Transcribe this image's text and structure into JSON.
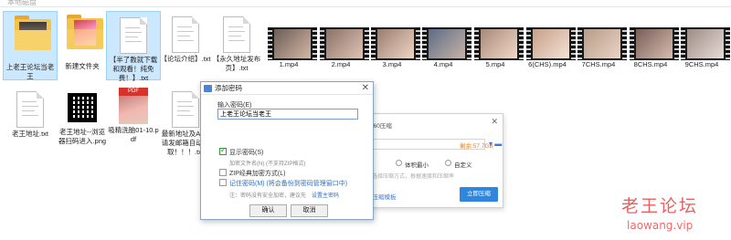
{
  "topbar": {
    "crumb": "本地磁盘"
  },
  "files_row1": [
    {
      "name": "上老王论坛当老王",
      "type": "folder-photo",
      "selected": true
    },
    {
      "name": "新建文件夹",
      "type": "folder-cover",
      "selected": false
    },
    {
      "name": "【半了教就下载和观看！纯免费！】.txt",
      "type": "txt",
      "selected": true
    },
    {
      "name": "【论坛介绍】.txt",
      "type": "txt",
      "selected": false
    },
    {
      "name": "【永久地址发布页】.txt",
      "type": "txt",
      "selected": false
    }
  ],
  "videos": [
    {
      "name": "1.mp4",
      "color": "#6b5d55"
    },
    {
      "name": "2.mp4",
      "color": "#8a7268"
    },
    {
      "name": "3.mp4",
      "color": "#9a7c6e"
    },
    {
      "name": "4.mp4",
      "color": "#5b6c86"
    },
    {
      "name": "5.mp4",
      "color": "#a88977"
    },
    {
      "name": "6(CHS).mp4",
      "color": "#c7a089"
    },
    {
      "name": "7CHS.mp4",
      "color": "#b89b87"
    },
    {
      "name": "8CHS.mp4",
      "color": "#765e58"
    },
    {
      "name": "9CHS.mp4",
      "color": "#9c8c86"
    }
  ],
  "files_row2": [
    {
      "name": "老王地址.txt",
      "type": "txt"
    },
    {
      "name": "老王地址--浏览器扫码进入.png",
      "type": "qr"
    },
    {
      "name": "吸精洗脑01-10.pdf",
      "type": "pdf",
      "badge": "PDF"
    },
    {
      "name": "最新地址及APP请发邮箱自动获取！！！.txt",
      "type": "txt"
    }
  ],
  "dialog": {
    "title": "添加密码",
    "input_label": "输入密码(E)",
    "password_value": "上老王论坛当老王",
    "show_password": "显示密码(S)",
    "encrypt_names_note": "加密文件名(N) (不支持ZIP格式)",
    "zip_classic": "ZIP经典加密方式(L)",
    "remember": "记住密码(M) (将会备份到密码管理窗口中)",
    "warning": "注：密码没有安全加密，建议先",
    "warning_link": "设置主密码",
    "ok": "确认",
    "cancel": "取消"
  },
  "zip_panel": {
    "title": "- 360压缩",
    "free_space": "剩余:57.7GB",
    "opt1": "快",
    "opt2": "体积最小",
    "opt3": "自定义",
    "hint": "请选择压缩方式，根据速度和压缩率",
    "template": "建压缩模板",
    "start": "立即压缩"
  },
  "watermark": {
    "title": "老王论坛",
    "url": "laowang.vip"
  },
  "colors": {
    "selection": "#cce8ff",
    "accent": "#2e86de",
    "watermark": "#e84545"
  }
}
